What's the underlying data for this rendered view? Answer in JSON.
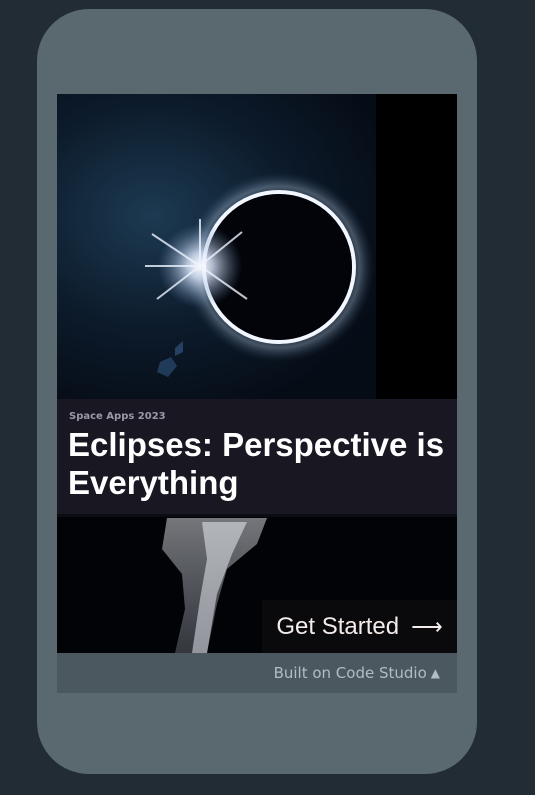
{
  "card": {
    "eyebrow": "Space Apps 2023",
    "title": "Eclipses: Perspective is Everything",
    "cta_label": "Get Started",
    "cta_icon": "arrow-right-icon"
  },
  "footer": {
    "label": "Built on Code Studio",
    "icon": "caret-up-icon"
  },
  "colors": {
    "page_bg": "#222c34",
    "phone_frame": "#5a6870",
    "title_bar": "#181722",
    "footer_bar": "#4c5860"
  }
}
